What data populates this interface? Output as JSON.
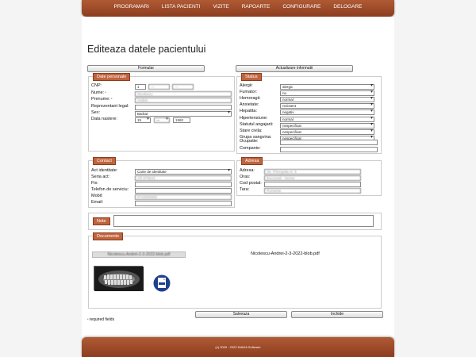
{
  "nav": {
    "items": [
      "PROGRAMARI",
      "LISTA PACIENTI",
      "VIZITE",
      "RAPOARTE",
      "CONFIGURARE",
      "DELOGARE"
    ]
  },
  "page_title": "Editeaza datele pacientului",
  "buttons": {
    "formular": "Formular",
    "actualizare": "Actualizare informatii",
    "salveaza": "Salveaza",
    "inchide": "Inchide"
  },
  "personal": {
    "legend": "Date personale",
    "cnp_label": "CNP:",
    "cnp_1": "1",
    "cnp_2": "—",
    "cnp_3": "—",
    "nume_label": "Nume:",
    "nume_value": "Nicolescu",
    "prenume_label": "Prenume:",
    "prenume_value": "Andrei",
    "repr_label": "Reprezentant legal:",
    "sex_label": "Sex:",
    "sex_value": "Barbat",
    "dob_label": "Data nastere:",
    "dob_day": "15",
    "dob_month": "—",
    "dob_year": "1960"
  },
  "status": {
    "legend": "Status",
    "rows": [
      {
        "label": "Alergii:",
        "value": "alergic"
      },
      {
        "label": "Fumator:",
        "value": "nu"
      },
      {
        "label": "Hemoragii:",
        "value": "normal"
      },
      {
        "label": "Anxietate:",
        "value": "rezistent"
      },
      {
        "label": "Hepatita:",
        "value": "negativ"
      },
      {
        "label": "Hipertensiune:",
        "value": "normal"
      },
      {
        "label": "Statutul angajarii:",
        "value": "nespecificat"
      },
      {
        "label": "Stare civila:",
        "value": "nespecificat"
      },
      {
        "label": "Grupa sangvina:",
        "value": "nespecificat"
      }
    ],
    "ocupatie_label": "Ocupatie:",
    "companie_label": "Companie:"
  },
  "contact": {
    "legend": "Contact",
    "act_label": "Act identitate:",
    "act_value": "Carte de identitate",
    "seria_label": "Seria act:",
    "seria_value": "AR 876543",
    "fix_label": "Fix:",
    "telserv_label": "Telefon de serviciu:",
    "mobil_label": "Mobil:",
    "mobil_value": "0744000000",
    "email_label": "Email:"
  },
  "adresa": {
    "legend": "Adresa",
    "adresa_label": "Adresa:",
    "adresa_value": "Str. Principala nr. 5",
    "oras_label": "Oras:",
    "oras_value": "Bucuresti - Sector",
    "cod_label": "Cod postal:",
    "tara_label": "Tara:",
    "tara_value": "Romania"
  },
  "note": {
    "legend": "Note"
  },
  "documente": {
    "legend": "Documente",
    "file1": "Nicolescu-Andrei-2-3-2022-blob.pdf",
    "file2": "Nicolescu-Andrei-2-3-2022-blob.pdf"
  },
  "required_note": "required fields",
  "footer": "(c) 2009 - 2022 DIADA Software"
}
